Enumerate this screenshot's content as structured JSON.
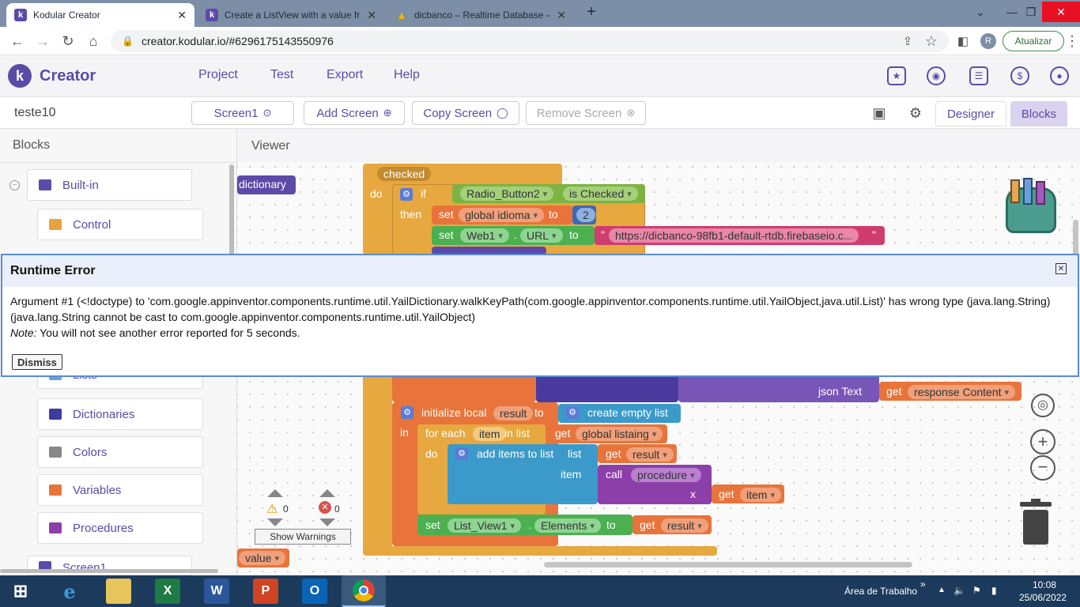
{
  "browser": {
    "tabs": [
      {
        "title": "Kodular Creator",
        "favicon": "k",
        "favicon_color": "#5b4ba8",
        "active": true
      },
      {
        "title": "Create a ListView with a value fro",
        "favicon": "k",
        "favicon_color": "#5b4ba8",
        "active": false
      },
      {
        "title": "dicbanco – Realtime Database – ",
        "favicon": "▲",
        "favicon_color": "#f4b400",
        "active": false
      }
    ],
    "new_tab_label": "+",
    "url": "creator.kodular.io/#6296175143550976",
    "avatar_letter": "R",
    "update_label": "Atualizar"
  },
  "app": {
    "brand": "Creator",
    "logo_letter": "k",
    "menu": [
      "Project",
      "Test",
      "Export",
      "Help"
    ],
    "project_name": "teste10",
    "screen_select": "Screen1",
    "add_screen": "Add Screen",
    "copy_screen": "Copy Screen",
    "remove_screen": "Remove Screen",
    "designer": "Designer",
    "blocks": "Blocks",
    "accent": "#5b4ba8"
  },
  "blocks_panel": {
    "title": "Blocks",
    "builtin": "Built-in",
    "items": [
      {
        "label": "Control",
        "color": "#e6a23c"
      },
      {
        "label": "Dictionaries",
        "color": "#3c3c9e"
      },
      {
        "label": "Colors",
        "color": "#888888"
      },
      {
        "label": "Variables",
        "color": "#e8743b"
      },
      {
        "label": "Procedures",
        "color": "#8c3fa8"
      }
    ],
    "screen_item": "Screen1",
    "partial_item": "Lists"
  },
  "viewer": {
    "title": "Viewer",
    "warnings_count": "0",
    "errors_count": "0",
    "show_warnings": "Show Warnings",
    "blocks": {
      "dictionary": "dictionary",
      "checked": "checked",
      "do": "do",
      "if": "if",
      "then": "then",
      "radio": "Radio_Button2",
      "is_checked": "is Checked",
      "set": "set",
      "global_idioma": "global idioma",
      "to": "to",
      "num2": "2",
      "web1": "Web1",
      "url": "URL",
      "url_value": "https://dicbanco-98fb1-default-rtdb.firebaseio.c...",
      "json_text": "json Text",
      "get": "get",
      "response_content": "response Content",
      "initialize_local": "initialize local",
      "result": "result",
      "create_empty_list": "create empty list",
      "in": "in",
      "for_each": "for each",
      "item": "item",
      "in_list": "in list",
      "global_listaing": "global listaing",
      "add_items": "add items to list",
      "list": "list",
      "call": "call",
      "procedure": "procedure",
      "x": "x",
      "list_view1": "List_View1",
      "elements": "Elements",
      "value": "value"
    }
  },
  "error": {
    "title": "Runtime Error",
    "line1": "Argument #1 (<!doctype) to 'com.google.appinventor.components.runtime.util.YailDictionary.walkKeyPath(com.google.appinventor.components.runtime.util.YailObject,java.util.List)' has wrong type (java.lang.String)",
    "line2": "(java.lang.String cannot be cast to com.google.appinventor.components.runtime.util.YailObject)",
    "note_label": "Note:",
    "note_text": " You will not see another error reported for 5 seconds.",
    "dismiss": "Dismiss"
  },
  "taskbar": {
    "desktop_label": "Área de Trabalho",
    "time": "10:08",
    "date": "25/06/2022"
  }
}
